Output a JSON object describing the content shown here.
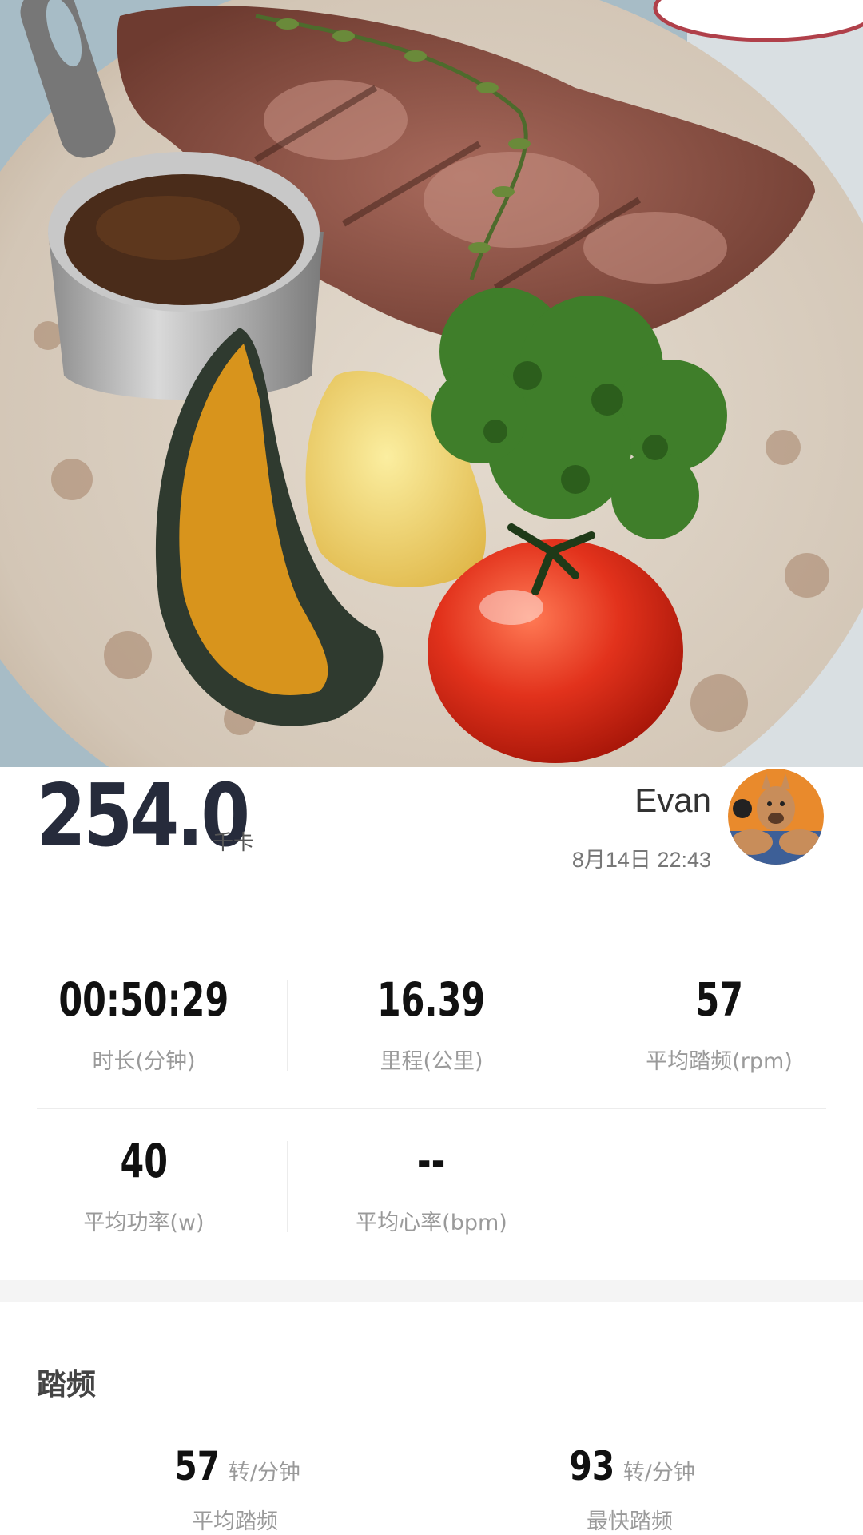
{
  "summary": {
    "calories": "254.0",
    "calories_unit": "千卡",
    "user_name": "Evan",
    "date_time": "8月14日 22:43"
  },
  "stats": [
    {
      "value": "00:50:29",
      "label": "时长(分钟)"
    },
    {
      "value": "16.39",
      "label": "里程(公里)"
    },
    {
      "value": "57",
      "label": "平均踏频(rpm)"
    },
    {
      "value": "40",
      "label": "平均功率(w)"
    },
    {
      "value": "--",
      "label": "平均心率(bpm)"
    }
  ],
  "cadence": {
    "title": "踏频",
    "items": [
      {
        "value": "57",
        "unit": "转/分钟",
        "label": "平均踏频"
      },
      {
        "value": "93",
        "unit": "转/分钟",
        "label": "最快踏频"
      }
    ]
  },
  "colors": {
    "plate": "#d8cdbf",
    "pumpkin": "#d8941c",
    "broccoli": "#3f7e2a",
    "tomato": "#e0301c",
    "potato": "#f0d870"
  }
}
